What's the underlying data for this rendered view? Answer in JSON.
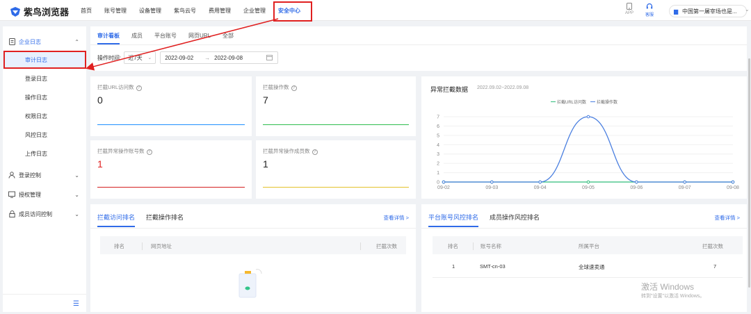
{
  "app": {
    "name": "紫鸟浏览器"
  },
  "nav": {
    "items": [
      "首页",
      "账号管理",
      "设备管理",
      "紫鸟云号",
      "费用管理",
      "企业管理",
      "安全中心"
    ],
    "active_index": 6
  },
  "topright": {
    "app_label": "APP",
    "service_label": "客服",
    "company": "中国第一屠宰场也是..."
  },
  "sidebar": {
    "groups": [
      {
        "label": "企业日志",
        "icon": "document-icon",
        "open": true
      },
      {
        "label": "登录控制",
        "icon": "user-icon",
        "open": false
      },
      {
        "label": "授权管理",
        "icon": "monitor-icon",
        "open": false
      },
      {
        "label": "成员访问控制",
        "icon": "lock-icon",
        "open": false
      }
    ],
    "log_items": [
      "审计日志",
      "登录日志",
      "操作日志",
      "权限日志",
      "风控日志",
      "上传日志"
    ],
    "active_item": "审计日志"
  },
  "tabs": {
    "items": [
      "审计看板",
      "成员",
      "平台账号",
      "网页URL",
      "全部"
    ],
    "active_index": 0
  },
  "filter": {
    "label": "操作时间:",
    "range_select": "近7天",
    "start_date": "2022-09-02",
    "end_date": "2022-09-08"
  },
  "stats": [
    {
      "title": "拦截URL访问数",
      "value": "0",
      "color": "#1e90ff"
    },
    {
      "title": "拦截操作数",
      "value": "7",
      "color": "#2ebd4e"
    },
    {
      "title": "拦截异常操作账号数",
      "value": "1",
      "color": "#d42020"
    },
    {
      "title": "拦截异常操作成员数",
      "value": "1",
      "color": "#e3c12a"
    }
  ],
  "chart_panel": {
    "title": "异常拦截数据",
    "range": "2022.09.02~2022.09.08"
  },
  "chart_data": {
    "type": "line",
    "x": [
      "09-02",
      "09-03",
      "09-04",
      "09-05",
      "09-06",
      "09-07",
      "09-08"
    ],
    "series": [
      {
        "name": "拦截URL访问数",
        "values": [
          0,
          0,
          0,
          0,
          0,
          0,
          0
        ],
        "color": "#2ebd7a"
      },
      {
        "name": "拦截操作数",
        "values": [
          0,
          0,
          0,
          7,
          0,
          0,
          0
        ],
        "color": "#4a7fe0"
      }
    ],
    "yticks": [
      0,
      1,
      2,
      3,
      4,
      5,
      6,
      7
    ],
    "ylim": [
      0,
      7
    ]
  },
  "panel_left": {
    "tabs": [
      "拦截访问排名",
      "拦截操作排名"
    ],
    "details": "查看详情 >",
    "columns": [
      "排名",
      "网页地址",
      "拦截次数"
    ]
  },
  "panel_right": {
    "tabs": [
      "平台账号风控排名",
      "成员操作风控排名"
    ],
    "details": "查看详情 >",
    "columns": [
      "排名",
      "账号名称",
      "所属平台",
      "拦截次数"
    ],
    "rows": [
      {
        "rank": "1",
        "account": "SMT-cn-03",
        "platform": "全球速卖通",
        "count": "7"
      }
    ]
  },
  "watermark": {
    "line1": "激活 Windows",
    "line2": "转到\"设置\"以激活 Windows。"
  }
}
